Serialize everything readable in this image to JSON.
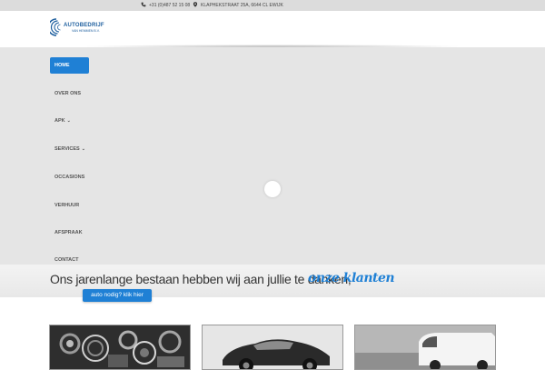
{
  "topbar": {
    "phone": "+31 (0)487 52 15 08",
    "address": "KLAPHEKSTRAAT 25A, 6644 CL EWIJK",
    "phone_icon": "phone-icon",
    "address_icon": "map-marker-icon"
  },
  "logo": {
    "line1": "AUTOBEDRIJF",
    "line2": "VAN HEMMEN B.V.",
    "icon": "wheel-logo-icon"
  },
  "nav": {
    "items": [
      {
        "label": "HOME",
        "active": true
      },
      {
        "label": "OVER ONS"
      },
      {
        "label": "APK",
        "dropdown": true
      },
      {
        "label": "SERVICES",
        "dropdown": true
      },
      {
        "label": "OCCASIONS"
      },
      {
        "label": "VERHUUR"
      },
      {
        "label": "AFSPRAAK"
      },
      {
        "label": "CONTACT"
      }
    ],
    "chevron": "⌄"
  },
  "tagline": {
    "text": "Ons jarenlange bestaan hebben wij aan jullie te danken,",
    "script": "onze klanten"
  },
  "cta": {
    "label": "auto nodig? klik hier"
  },
  "cards": [
    {
      "subject": "engine"
    },
    {
      "subject": "car"
    },
    {
      "subject": "van"
    }
  ],
  "colors": {
    "accent": "#1f80d5",
    "topbar": "#dcdcdc",
    "hero": "#e5e5e5"
  }
}
